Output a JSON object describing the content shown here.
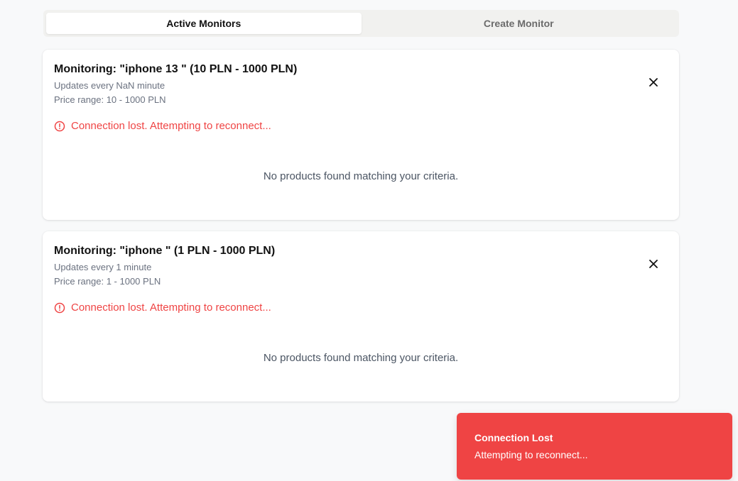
{
  "tabs": [
    {
      "label": "Active Monitors",
      "active": true
    },
    {
      "label": "Create Monitor",
      "active": false
    }
  ],
  "monitors": [
    {
      "title": "Monitoring: \"iphone 13 \" (10 PLN - 1000 PLN)",
      "updates": "Updates every NaN minute",
      "price_range": "Price range: 10 - 1000 PLN",
      "error": "Connection lost. Attempting to reconnect...",
      "empty_message": "No products found matching your criteria."
    },
    {
      "title": "Monitoring: \"iphone \" (1 PLN - 1000 PLN)",
      "updates": "Updates every 1 minute",
      "price_range": "Price range: 1 - 1000 PLN",
      "error": "Connection lost. Attempting to reconnect...",
      "empty_message": "No products found matching your criteria."
    }
  ],
  "toast": {
    "title": "Connection Lost",
    "message": "Attempting to reconnect..."
  },
  "icons": {
    "close": "close-icon",
    "error": "alert-circle-icon"
  },
  "colors": {
    "error": "#ef4444",
    "toast_bg": "#ef4444",
    "muted": "#6b7280"
  }
}
